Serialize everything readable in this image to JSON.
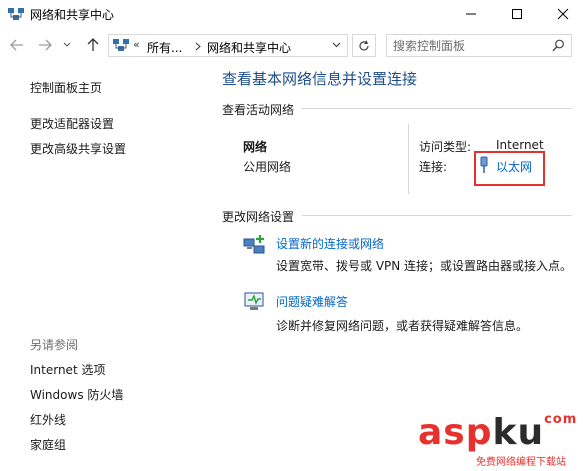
{
  "window": {
    "title": "网络和共享中心"
  },
  "address": {
    "crumbs": [
      "所有...",
      "网络和共享中心"
    ],
    "overflow": "«",
    "search_placeholder": "搜索控制面板"
  },
  "sidebar": {
    "home": "控制面板主页",
    "links": [
      "更改适配器设置",
      "更改高级共享设置"
    ],
    "see_also_title": "另请参阅",
    "see_also": [
      "Internet 选项",
      "Windows 防火墙",
      "红外线",
      "家庭组"
    ]
  },
  "main": {
    "title": "查看基本网络信息并设置连接",
    "active_section": "查看活动网络",
    "network": {
      "name": "网络",
      "type": "公用网络",
      "access_label": "访问类型:",
      "access_value": "Internet",
      "conn_label": "连接:",
      "conn_value": "以太网"
    },
    "change_section": "更改网络设置",
    "tasks": [
      {
        "link": "设置新的连接或网络",
        "desc": "设置宽带、拨号或 VPN 连接；或设置路由器或接入点。"
      },
      {
        "link": "问题疑难解答",
        "desc": "诊断并修复网络问题，或者获得疑难解答信息。"
      }
    ]
  },
  "watermark": {
    "main": "asp",
    "k": "ku",
    "suffix": "com",
    "sub": "免费网络编程下载站"
  },
  "colors": {
    "link": "#0066cc",
    "title": "#1e4e8c",
    "highlight": "#e6312d"
  }
}
